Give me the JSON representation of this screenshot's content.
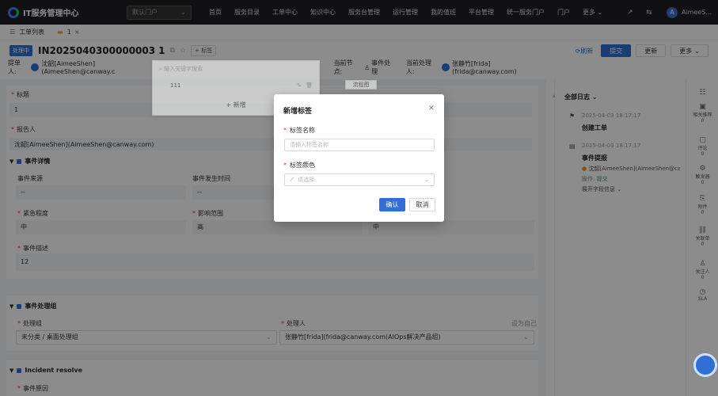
{
  "topbar": {
    "app_title": "IT服务管理中心",
    "portal_select": "默认门户",
    "nav": [
      "首页",
      "服务目录",
      "工单中心",
      "知识中心",
      "服务台管理",
      "运行管理",
      "我的值班",
      "平台管理",
      "统一服务门户",
      "门户",
      "更多"
    ],
    "user_name": "AimeeS...",
    "user_initial": "A"
  },
  "tabs": [
    {
      "label": "工单列表"
    },
    {
      "label": "1"
    }
  ],
  "ticket": {
    "status": "处理中",
    "number": "IN2025040300000003",
    "title_suffix": "1",
    "tag_button": "标签",
    "actions": {
      "refresh": "刷新",
      "submit": "提交",
      "update": "更新",
      "more": "更多"
    }
  },
  "meta": {
    "submitter_label": "提单人:",
    "submitter": "沈韶[AimeeShen](AimeeShen@canway.c",
    "node_label": "当前节点:",
    "node": "事件处理",
    "handler_label": "当前处理人:",
    "handler": "张静竹[frida](frida@canway.com)"
  },
  "dropdown": {
    "search_placeholder": "输入关键字搜索",
    "item": "111",
    "add_label": "新增",
    "flow_button": "流程图"
  },
  "form": {
    "title_label": "标题",
    "title_value": "1",
    "reporter_label": "报告人",
    "reporter_value": "沈韶[AimeeShen](AimeeShen@canway.com)",
    "event_detail_section": "事件详情",
    "source_label": "事件来源",
    "source_value": "--",
    "time_label": "事件发生时间",
    "time_value": "--",
    "urgency_label": "紧急程度",
    "urgency_value": "中",
    "impact_label": "影响范围",
    "impact_value": "高",
    "priority_value": "中",
    "desc_label": "事件描述",
    "desc_value": "12",
    "group_section": "事件处理组",
    "group_label": "处理组",
    "group_value": "未分类 / 桌面处理组",
    "handler_label": "处理人",
    "handler_value": "张静竹[frida](frida@canway.com(AIOps解决产品组)",
    "set_self": "设为自己",
    "resolve_section": "Incident resolve",
    "cause_label": "事件原因"
  },
  "log": {
    "title": "全部日志",
    "items": [
      {
        "time": "2025-04-03 18:17:17",
        "name": "创建工单"
      },
      {
        "time": "2025-04-03 18:17:17",
        "name": "事件提报",
        "user": "沈韶[AimeeShen](AimeeShen@canw...",
        "op_label": "操作:",
        "op": "提交",
        "expand": "展开字段信息"
      }
    ]
  },
  "rightbar": [
    {
      "label": "相关推荐",
      "count": "0"
    },
    {
      "label": "评论",
      "count": "0"
    },
    {
      "label": "触发器",
      "count": "0"
    },
    {
      "label": "附件",
      "count": "0"
    },
    {
      "label": "关联单",
      "count": "0"
    },
    {
      "label": "关注人",
      "count": "0"
    },
    {
      "label": "SLA",
      "count": ""
    }
  ],
  "modal": {
    "title": "新增标签",
    "name_label": "标签名称",
    "name_placeholder": "请输入标签名称",
    "color_label": "标签颜色",
    "color_placeholder": "请选择",
    "confirm": "确认",
    "cancel": "取消"
  }
}
